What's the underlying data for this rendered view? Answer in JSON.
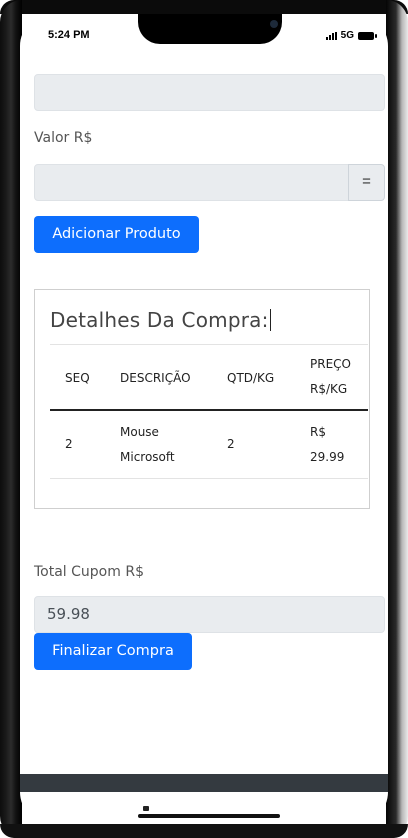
{
  "status_bar": {
    "time": "5:24 PM",
    "network": "5G"
  },
  "form": {
    "top_field_value": "",
    "valor_label": "Valor R$",
    "valor_value": "",
    "equals_label": "=",
    "add_button": "Adicionar Produto"
  },
  "details": {
    "title": "Detalhes Da Compra:",
    "headers": {
      "seq": "SEQ",
      "desc": "DESCRIÇÃO",
      "qty": "QTD/KG",
      "price_1": "PREÇO",
      "price_2": "R$/KG"
    },
    "rows": [
      {
        "seq": "2",
        "desc_1": "Mouse",
        "desc_2": "Microsoft",
        "qty": "2",
        "price_1": "R$",
        "price_2": "29.99"
      }
    ]
  },
  "total": {
    "label": "Total Cupom R$",
    "value": "59.98",
    "finish_button": "Finalizar Compra"
  },
  "colors": {
    "primary": "#0d6efd",
    "input_bg": "#e9ecef",
    "footer": "#343a40"
  }
}
